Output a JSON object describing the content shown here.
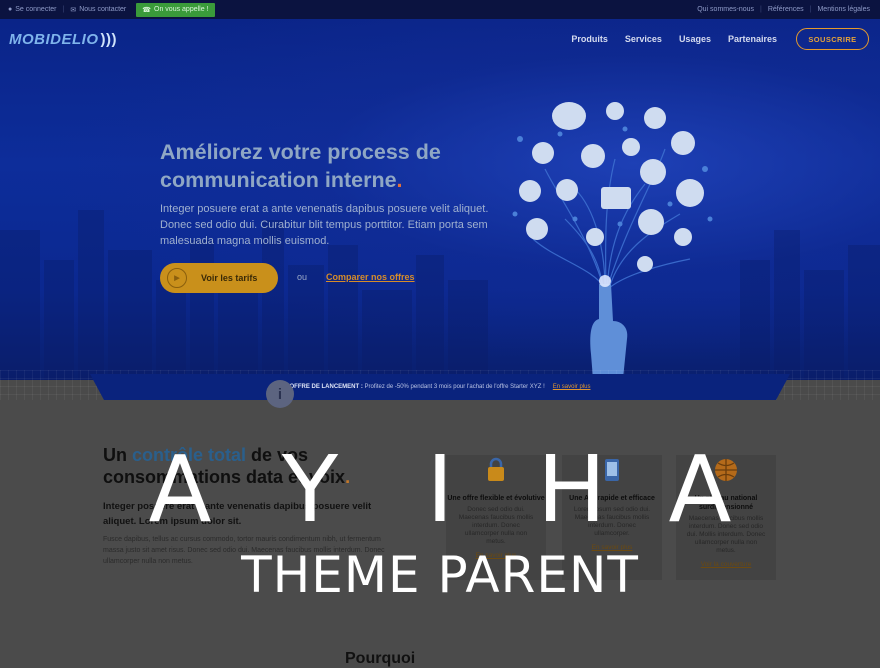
{
  "topbar": {
    "login": "Se connecter",
    "contact": "Nous contacter",
    "callback": "On vous appelle !",
    "links": [
      "Qui sommes-nous",
      "Références",
      "Mentions légales"
    ]
  },
  "header": {
    "logo": "MOBIDELIO",
    "menu": [
      "Produits",
      "Services",
      "Usages",
      "Partenaires"
    ],
    "subscribe": "SOUSCRIRE"
  },
  "hero": {
    "title_line1": "Améliorez votre process de",
    "title_line2": "communication interne",
    "title_dot": ".",
    "lead": "Integer posuere erat a ante venenatis dapibus posuere velit aliquet. Donec sed odio dui. Curabitur blit tempus porttitor. Etiam porta sem malesuada magna mollis euismod.",
    "cta": "Voir les tarifs",
    "or": "ou",
    "compare": "Comparer nos offres"
  },
  "promo": {
    "label": "OFFRE DE LANCEMENT :",
    "text": "Profitez de -50% pendant 3 mois pour l'achat de l'offre Starter XYZ !",
    "more": "En savoir plus"
  },
  "section": {
    "title_a": "Un ",
    "title_hl": "contrôle total",
    "title_b": " de vos",
    "title_line2": "consommations data et voix",
    "title_dot": ".",
    "intro": "Integer posuere erat a ante venenatis dapibus posuere velit aliquet. Lorem ipsum dolor sit.",
    "body": "Fusce dapibus, tellus ac cursus commodo, tortor mauris condimentum nibh, ut fermentum massa justo sit amet risus. Donec sed odio dui. Maecenas faucibus mollis interdum. Donec ullamcorper nulla non metus.",
    "features": [
      {
        "title": "Une offre flexible et évolutive",
        "text": "Donec sed odio dui. Maecenas faucibus mollis interdum. Donec ullamcorper nulla non metus.",
        "link": "En savoir plus"
      },
      {
        "title": "Une API rapide et efficace",
        "text": "Lorem ipsum sed odio dui. Maecenas faucibus mollis interdum. Donec ullamcorper.",
        "link": "En savoir plus"
      },
      {
        "title": "Un réseau national surdimensionné",
        "text": "Maecenas faucibus mollis interdum. Donec sed odio dui. Mollis interdum. Donec ullamcorper nulla non metus.",
        "link": "Voir la couverture"
      }
    ],
    "next_heading": "Pourquoi"
  },
  "watermark": {
    "letters": [
      "A",
      "Y",
      "I",
      "H",
      "A"
    ],
    "subtitle": "THEME PARENT"
  },
  "colors": {
    "hero_bg": "#0d2d9a",
    "accent_orange": "#e49a2d",
    "callback_green": "#3a9b3a",
    "promo_bg": "#0a237d"
  }
}
